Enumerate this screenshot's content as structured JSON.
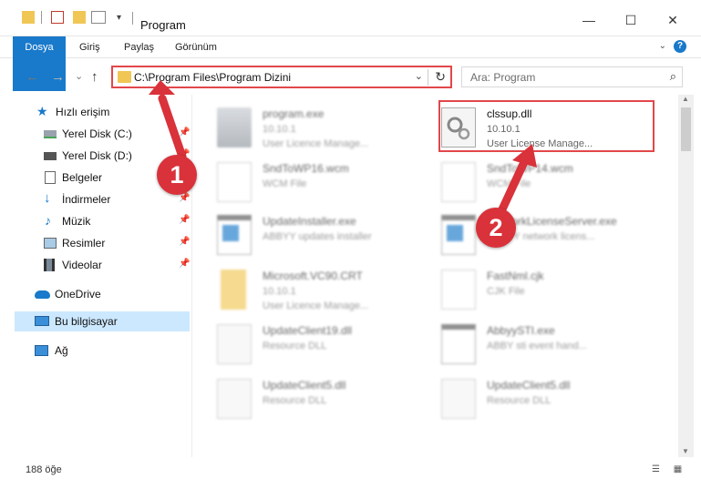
{
  "window": {
    "title": "Program",
    "controls": {
      "minimize": "—",
      "maximize": "☐",
      "close": "✕"
    }
  },
  "ribbon": {
    "tabs": [
      {
        "label": "Dosya"
      },
      {
        "label": "Giriş"
      },
      {
        "label": "Paylaş"
      },
      {
        "label": "Görünüm"
      }
    ],
    "help": "?",
    "expand": "⌄"
  },
  "navigation": {
    "back": "←",
    "forward": "→",
    "recent": "⌄",
    "up": "↑",
    "address": "C:\\Program Files\\Program Dizini",
    "dropdown": "⌄",
    "refresh": "↻",
    "search_placeholder": "Ara: Program",
    "search_icon": "⌕"
  },
  "sidebar": {
    "items": [
      {
        "label": "Hızlı erişim",
        "icon": "star-icon",
        "pin": ""
      },
      {
        "label": "Yerel Disk (C:)",
        "icon": "drive-icon",
        "pin": "📌"
      },
      {
        "label": "Yerel Disk (D:)",
        "icon": "drive-icon",
        "pin": "📌"
      },
      {
        "label": "Belgeler",
        "icon": "documents-icon",
        "pin": "📌"
      },
      {
        "label": "İndirmeler",
        "icon": "downloads-icon",
        "pin": "📌"
      },
      {
        "label": "Müzik",
        "icon": "music-icon",
        "pin": "📌"
      },
      {
        "label": "Resimler",
        "icon": "pictures-icon",
        "pin": "📌"
      },
      {
        "label": "Videolar",
        "icon": "videos-icon",
        "pin": "📌"
      },
      {
        "label": "OneDrive",
        "icon": "cloud-icon",
        "pin": ""
      },
      {
        "label": "Bu bilgisayar",
        "icon": "computer-icon",
        "pin": ""
      },
      {
        "label": "Ağ",
        "icon": "network-icon",
        "pin": ""
      }
    ]
  },
  "files": [
    {
      "name": "program.exe",
      "line2": "10.10.1",
      "line3": "User Licence Manage...",
      "icon": "exe-icon"
    },
    {
      "name": "clssup.dll",
      "line2": "10.10.1",
      "line3": "User License Manage...",
      "icon": "dll-icon"
    },
    {
      "name": "SndToWP16.wcm",
      "line2": "WCM File",
      "line3": "",
      "icon": "blank-file-icon"
    },
    {
      "name": "SndToWP14.wcm",
      "line2": "WCM File",
      "line3": "",
      "icon": "blank-file-icon"
    },
    {
      "name": "UpdateInstaller.exe",
      "line2": "ABBYY updates installer",
      "line3": "",
      "icon": "window-app-icon"
    },
    {
      "name": "NetworkLicenseServer.exe",
      "line2": "ABBYY network licens...",
      "line3": "",
      "icon": "window-app-icon"
    },
    {
      "name": "Microsoft.VC90.CRT",
      "line2": "10.10.1",
      "line3": "User Licence Manage...",
      "icon": "folder-icon"
    },
    {
      "name": "FastNml.cjk",
      "line2": "CJK File",
      "line3": "",
      "icon": "blank-file-icon"
    },
    {
      "name": "UpdateClient19.dll",
      "line2": "Resource DLL",
      "line3": "",
      "icon": "dll-icon"
    },
    {
      "name": "AbbyySTI.exe",
      "line2": "ABBY sti event hand...",
      "line3": "",
      "icon": "window-app-icon"
    },
    {
      "name": "UpdateClient5.dll",
      "line2": "Resource DLL",
      "line3": "",
      "icon": "dll-icon"
    },
    {
      "name": "UpdateClient5.dll",
      "line2": "Resource DLL",
      "line3": "",
      "icon": "dll-icon"
    }
  ],
  "status": {
    "count": "188 öğe",
    "view_icons": "☰ ▦"
  },
  "annotations": {
    "step1": "1",
    "step2": "2"
  },
  "colors": {
    "accent": "#1979ca",
    "highlight": "#e2474a",
    "badge": "#d9323a",
    "folder": "#f0c755"
  }
}
